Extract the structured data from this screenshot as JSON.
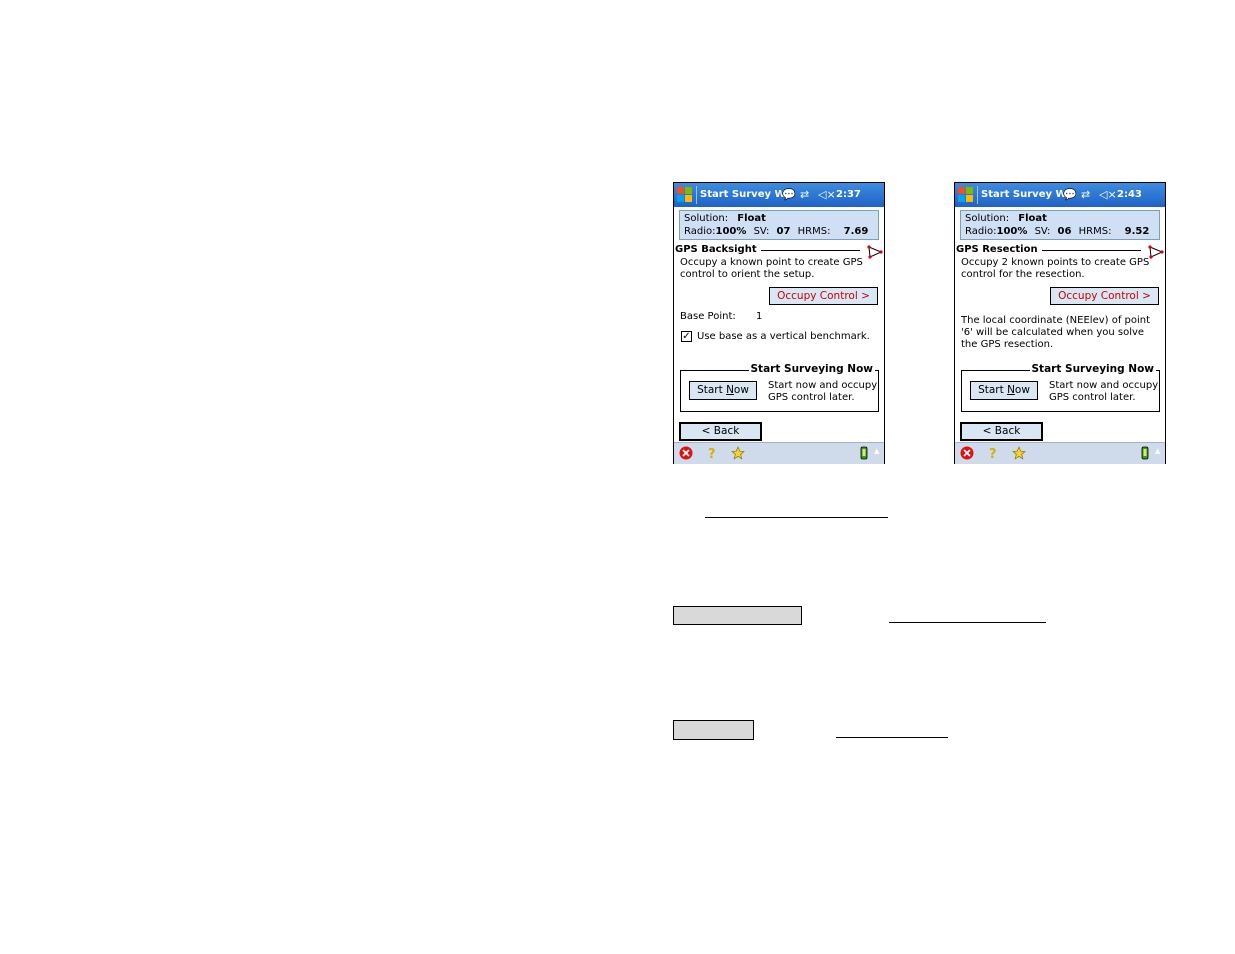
{
  "screens": [
    {
      "title": "Start Survey W",
      "time": "2:37",
      "solution_label": "Solution:",
      "solution_value": "Float",
      "radio_label": "Radio:",
      "radio_value": "100%",
      "sv_label": "SV:",
      "sv_value": "07",
      "hrms_label": "HRMS:",
      "hrms_value": "7.69",
      "section_title": "GPS Backsight",
      "description": "Occupy a known point to create GPS control to orient the setup.",
      "occupy_button": "Occupy Control >",
      "base_point_label": "Base Point:",
      "base_point_value": "1",
      "benchmark_label": "Use base as a vertical benchmark.",
      "benchmark_checked": "✓",
      "group_title": "Start Surveying Now",
      "start_button_pre": "Start ",
      "start_button_ul": "N",
      "start_button_post": "ow",
      "group_text": "Start now and occupy GPS control later.",
      "back_button": "< Back"
    },
    {
      "title": "Start Survey W",
      "time": "2:43",
      "solution_label": "Solution:",
      "solution_value": "Float",
      "radio_label": "Radio:",
      "radio_value": "100%",
      "sv_label": "SV:",
      "sv_value": "06",
      "hrms_label": "HRMS:",
      "hrms_value": "9.52",
      "section_title": "GPS Resection",
      "description": "Occupy 2 known points to create GPS control for the resection.",
      "occupy_button": "Occupy Control >",
      "info_text": "The local coordinate (NEElev) of point '6' will be calculated when you solve the GPS resection.",
      "group_title": "Start Surveying Now",
      "start_button_pre": "Start ",
      "start_button_ul": "N",
      "start_button_post": "ow",
      "group_text": "Start now and occupy GPS control later.",
      "back_button": "< Back"
    }
  ],
  "icons": {
    "start": "windows-logo-icon",
    "chat": "speech-bubble-icon",
    "sync": "arrows-sync-icon",
    "volume": "speaker-mute-icon",
    "close": "close-icon",
    "help": "help-icon",
    "favorite": "star-icon",
    "gps": "gps-receiver-icon",
    "triangle": "triangle-target-icon"
  },
  "colors": {
    "titlebar": "#1f62c8",
    "panel": "#cfe0f5",
    "button": "#d9e6f4",
    "occupy_text": "#cc0000"
  }
}
